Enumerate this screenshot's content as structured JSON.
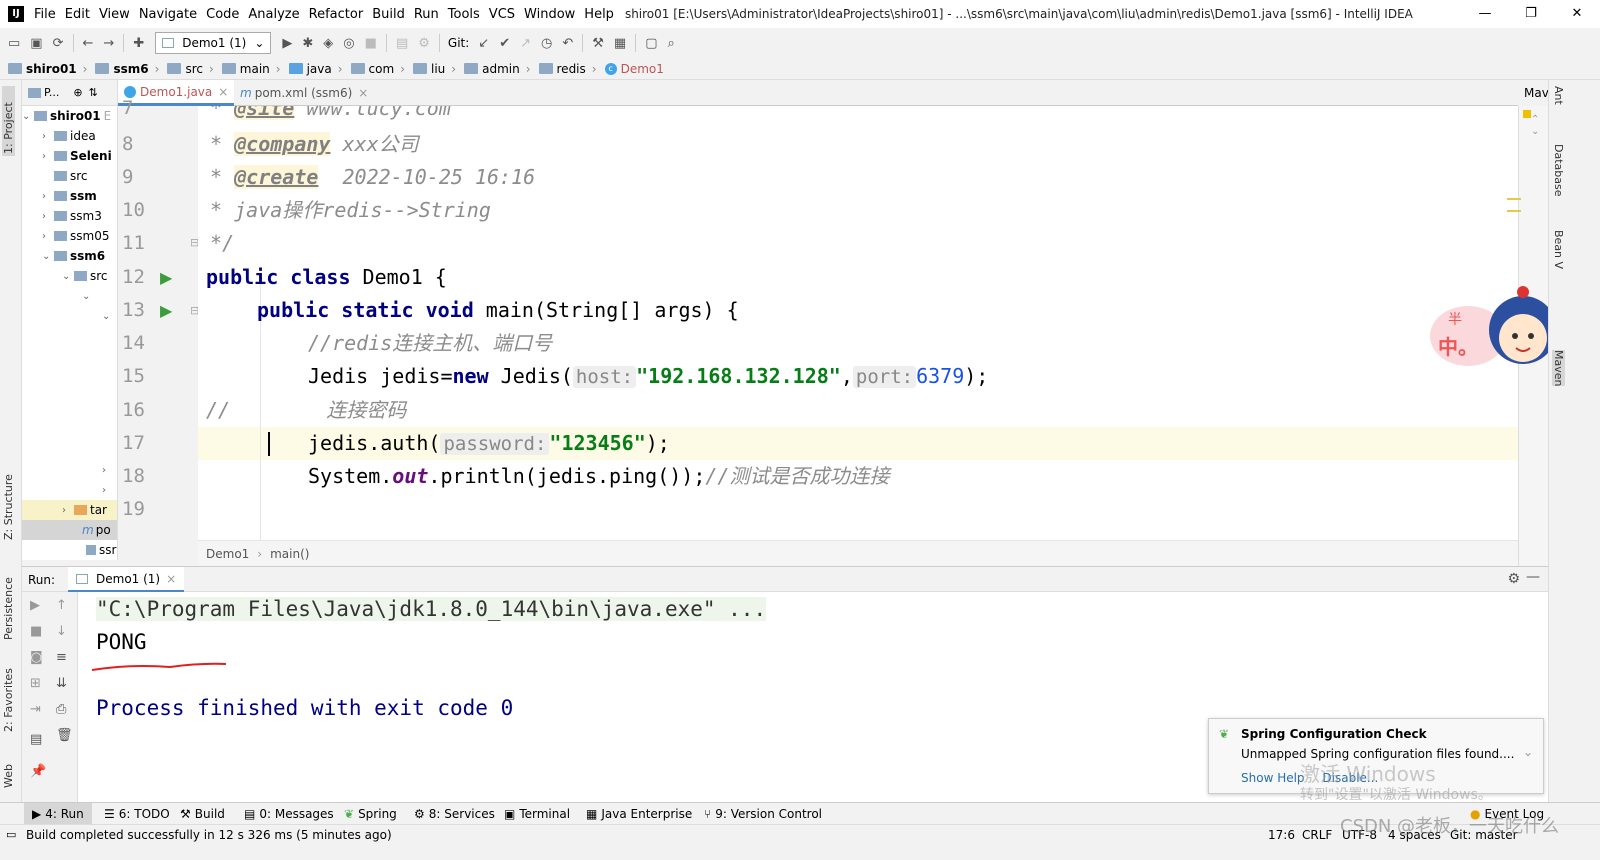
{
  "menu": [
    "File",
    "Edit",
    "View",
    "Navigate",
    "Code",
    "Analyze",
    "Refactor",
    "Build",
    "Run",
    "Tools",
    "VCS",
    "Window",
    "Help"
  ],
  "window_title": "shiro01 [E:\\Users\\Administrator\\IdeaProjects\\shiro01] - ...\\ssm6\\src\\main\\java\\com\\liu\\admin\\redis\\Demo1.java [ssm6] - IntelliJ IDEA",
  "window_controls": [
    "—",
    "❐",
    "✕"
  ],
  "toolbar": {
    "run_config": "Demo1 (1)",
    "git_label": "Git:"
  },
  "breadcrumbs": [
    "shiro01",
    "ssm6",
    "src",
    "main",
    "java",
    "com",
    "liu",
    "admin",
    "redis",
    "Demo1"
  ],
  "left_tabs": {
    "project": "1: Project",
    "structure": "Z: Structure",
    "persistence": "Persistence",
    "favorites": "2: Favorites",
    "web": "Web"
  },
  "project_panel": {
    "header": "P...",
    "items": [
      "shiro01",
      "E",
      "idea",
      "Seleni",
      "src",
      "ssm",
      "ssm3",
      "ssm05",
      "ssm6",
      "src",
      "tar",
      "po",
      "ssr"
    ]
  },
  "editor_tabs": [
    {
      "label": "Demo1.java",
      "close": "×"
    },
    {
      "label": "pom.xml (ssm6)",
      "close": "×"
    }
  ],
  "right_panel": {
    "maven": "Mav",
    "tabs": [
      "Ant",
      "Database",
      "Bean V",
      "Maven"
    ]
  },
  "code": {
    "line_numbers": [
      "7",
      "8",
      "9",
      "10",
      "11",
      "12",
      "13",
      "14",
      "15",
      "16",
      "17",
      "18",
      "19"
    ],
    "l7_tag": "@site",
    "l7_text": " www.lucy.com",
    "l8_tag": "@company",
    "l8_text": " xxx公司",
    "l9_tag": "@create",
    "l9_text": "  2022-10-25 16:16",
    "l10": " * java操作redis-->String",
    "l11": " */",
    "l12_kw": "public class",
    "l12_rest": " Demo1 {",
    "l13_kw": "public static void",
    "l13_rest": " main(String[] args) {",
    "l14": "//redis连接主机、端口号",
    "l15_a": "Jedis jedis=",
    "l15_new": "new",
    "l15_b": " Jedis(",
    "l15_hint1": "host:",
    "l15_str": "\"192.168.132.128\"",
    "l15_c": ",",
    "l15_hint2": "port:",
    "l15_num": "6379",
    "l15_d": ");",
    "l16": "//        连接密码",
    "l17_a": "jedis.auth(",
    "l17_hint": "password:",
    "l17_str": "\"123456\"",
    "l17_b": ");",
    "l18_a": "System.",
    "l18_field": "out",
    "l18_b": ".println(jedis.ping());",
    "l18_comment": "//测试是否成功连接"
  },
  "editor_breadcrumb": [
    "Demo1",
    "main()"
  ],
  "run_panel": {
    "label": "Run:",
    "tab": "Demo1 (1)",
    "close": "×"
  },
  "console": {
    "line1": "\"C:\\Program Files\\Java\\jdk1.8.0_144\\bin\\java.exe\" ...",
    "line2": "PONG",
    "line3": "Process finished with exit code 0"
  },
  "bottom_tabs": [
    "4: Run",
    "6: TODO",
    "Build",
    "0: Messages",
    "Spring",
    "8: Services",
    "Terminal",
    "Java Enterprise",
    "9: Version Control",
    "Event Log"
  ],
  "status": {
    "message": "Build completed successfully in 12 s 326 ms (5 minutes ago)",
    "position": "17:6",
    "line_sep": "CRLF",
    "encoding": "UTF-8",
    "indent": "4 spaces",
    "git": "Git: master"
  },
  "notification": {
    "title": "Spring Configuration Check",
    "body": "Unmapped Spring configuration files found....",
    "link1": "Show Help",
    "link2": "Disable..."
  },
  "watermark": {
    "activate": "激活 Windows",
    "goto": "转到\"设置\"以激活 Windows。",
    "csdn": "CSDN @老板，一天吃什么"
  },
  "mascot_text": {
    "top": "半",
    "main": "中。"
  },
  "colors": {
    "keyword": "#000080",
    "string": "#067d17",
    "number": "#1750eb",
    "comment": "#8c8c8c",
    "console_exit": "#000080"
  }
}
